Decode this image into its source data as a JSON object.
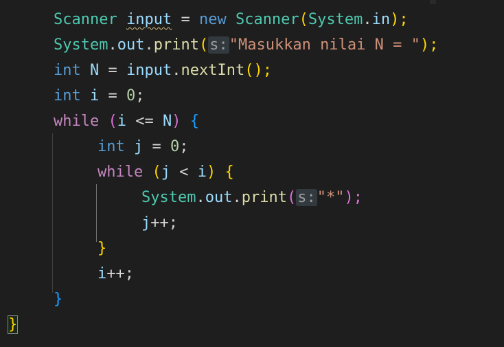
{
  "code": {
    "line1": {
      "t1": "Scanner",
      "t2": " ",
      "t3": "input",
      "t4": " = ",
      "t5": "new",
      "t6": " ",
      "t7": "Scanner",
      "t8": "(",
      "t9": "System",
      "t10": ".",
      "t11": "in",
      "t12": ");"
    },
    "line2": {
      "t1": "System",
      "t2": ".",
      "t3": "out",
      "t4": ".",
      "t5": "print",
      "t6": "(",
      "hint": "s:",
      "t7": "\"Masukkan nilai N = \"",
      "t8": ");"
    },
    "line3": {
      "t1": "int",
      "t2": " ",
      "t3": "N",
      "t4": " = ",
      "t5": "input",
      "t6": ".",
      "t7": "nextInt",
      "t8": "();"
    },
    "line4": {
      "t1": "int",
      "t2": " ",
      "t3": "i",
      "t4": " = ",
      "t5": "0",
      "t6": ";"
    },
    "line5": {
      "t1": "while",
      "t2": " ",
      "t3": "(",
      "t4": "i",
      "t5": " <= ",
      "t6": "N",
      "t7": ")",
      "t8": " ",
      "t9": "{"
    },
    "line6": {
      "t1": "int",
      "t2": " ",
      "t3": "j",
      "t4": " = ",
      "t5": "0",
      "t6": ";"
    },
    "line7": {
      "t1": "while",
      "t2": " ",
      "t3": "(",
      "t4": "j",
      "t5": " < ",
      "t6": "i",
      "t7": ")",
      "t8": " ",
      "t9": "{"
    },
    "line8": {
      "t1": "System",
      "t2": ".",
      "t3": "out",
      "t4": ".",
      "t5": "print",
      "t6": "(",
      "hint": "s:",
      "t7": "\"*\"",
      "t8": ");"
    },
    "line9": {
      "t1": "j",
      "t2": "++;"
    },
    "line10": {
      "t1": "}"
    },
    "line11": {
      "t1": "i",
      "t2": "++;"
    },
    "line12": {
      "t1": "}"
    },
    "line13": {
      "t1": "}"
    }
  },
  "theme": {
    "background": "#1e1e1e",
    "type_color": "#4ec9b0",
    "keyword_color": "#569cd6",
    "control_keyword_color": "#c586c0",
    "variable_color": "#9cdcfe",
    "number_color": "#b5cea8",
    "string_color": "#ce9178",
    "function_color": "#dcdcaa",
    "bracket_level1": "#ffd700",
    "bracket_level2": "#da70d6",
    "bracket_level3": "#179fff"
  }
}
